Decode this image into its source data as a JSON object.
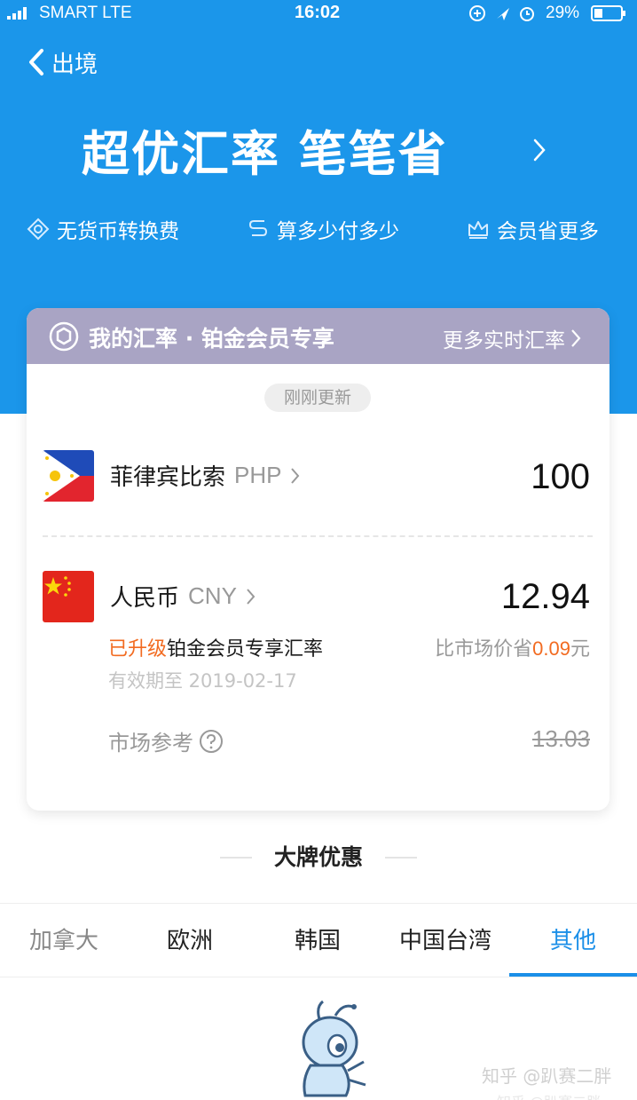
{
  "status_bar": {
    "carrier": "SMART   LTE",
    "time": "16:02",
    "battery": "29%"
  },
  "nav": {
    "back_label": "出境"
  },
  "hero": {
    "title": "超优汇率 笔笔省",
    "features": [
      {
        "icon": "no-fee-icon",
        "label": "无货币转换费"
      },
      {
        "icon": "exchange-icon",
        "label": "算多少付多少"
      },
      {
        "icon": "crown-icon",
        "label": "会员省更多"
      }
    ]
  },
  "card": {
    "header_title": "我的汇率 · 铂金会员专享",
    "more_link": "更多实时汇率",
    "update_pill": "刚刚更新",
    "from": {
      "name": "菲律宾比索",
      "code": "PHP",
      "amount": "100",
      "flag": "philippines-flag"
    },
    "to": {
      "name": "人民币",
      "code": "CNY",
      "amount": "12.94",
      "flag": "china-flag"
    },
    "upgrade_prefix": "已升级",
    "upgrade_text": "铂金会员专享汇率",
    "save_prefix": "比市场价省",
    "save_amount": "0.09",
    "save_unit": "元",
    "valid_until": "有效期至 2019-02-17",
    "market_ref_label": "市场参考",
    "market_ref_value": "13.03"
  },
  "deals": {
    "title": "大牌优惠",
    "tabs": [
      "加拿大",
      "欧洲",
      "韩国",
      "中国台湾",
      "其他"
    ],
    "active_tab": "其他"
  },
  "watermark": {
    "text": "知乎 @趴赛二胖",
    "underline": "知乎 @趴赛二胖"
  },
  "colors": {
    "brand_blue": "#1b96ea",
    "card_header": "#a9a4c4",
    "accent_orange": "#f26b21",
    "tab_active": "#1b8fe8"
  }
}
